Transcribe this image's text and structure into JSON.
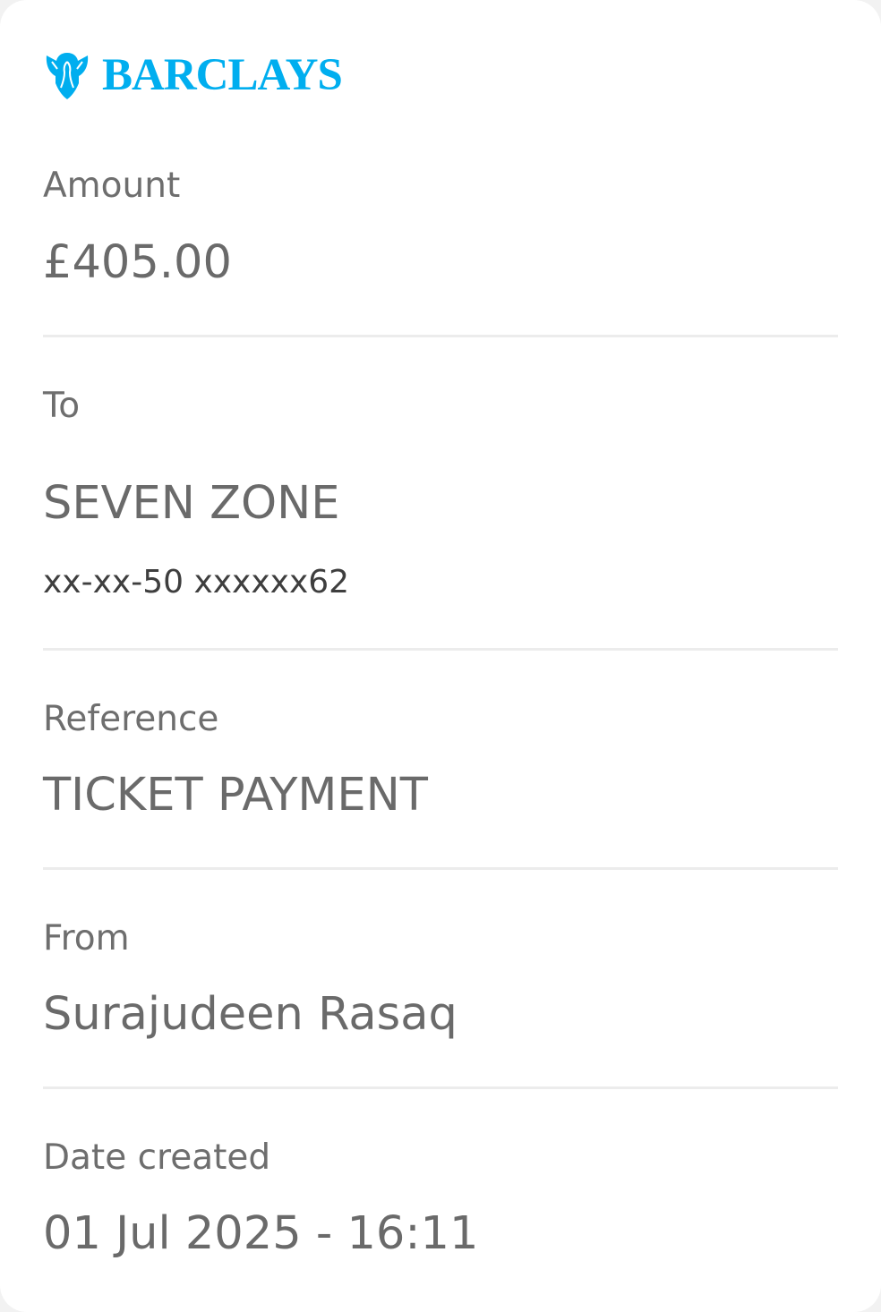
{
  "brand": {
    "name": "BARCLAYS",
    "color": "#00aeef",
    "icon": "eagle-icon"
  },
  "amount": {
    "label": "Amount",
    "value": "£405.00"
  },
  "to": {
    "label": "To",
    "name": "SEVEN ZONE",
    "account": "xx-xx-50 xxxxxx62"
  },
  "reference": {
    "label": "Reference",
    "value": "TICKET PAYMENT"
  },
  "from": {
    "label": "From",
    "value": "Surajudeen Rasaq"
  },
  "date_created": {
    "label": "Date created",
    "value": "01 Jul 2025 - 16:11"
  }
}
